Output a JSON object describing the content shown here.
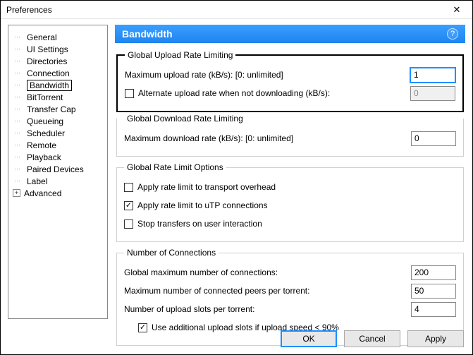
{
  "window": {
    "title": "Preferences"
  },
  "tree": {
    "items": [
      {
        "label": "General"
      },
      {
        "label": "UI Settings"
      },
      {
        "label": "Directories"
      },
      {
        "label": "Connection"
      },
      {
        "label": "Bandwidth",
        "selected": true
      },
      {
        "label": "BitTorrent"
      },
      {
        "label": "Transfer Cap"
      },
      {
        "label": "Queueing"
      },
      {
        "label": "Scheduler"
      },
      {
        "label": "Remote"
      },
      {
        "label": "Playback"
      },
      {
        "label": "Paired Devices"
      },
      {
        "label": "Label"
      },
      {
        "label": "Advanced",
        "expandable": true
      }
    ]
  },
  "panel": {
    "title": "Bandwidth",
    "upload": {
      "legend": "Global Upload Rate Limiting",
      "max_label": "Maximum upload rate (kB/s): [0: unlimited]",
      "max_value": "1",
      "alt_label": "Alternate upload rate when not downloading (kB/s):",
      "alt_checked": false,
      "alt_value": "0"
    },
    "download": {
      "legend": "Global Download Rate Limiting",
      "max_label": "Maximum download rate (kB/s): [0: unlimited]",
      "max_value": "0"
    },
    "options": {
      "legend": "Global Rate Limit Options",
      "overhead_label": "Apply rate limit to transport overhead",
      "overhead_checked": false,
      "utp_label": "Apply rate limit to uTP connections",
      "utp_checked": true,
      "stop_label": "Stop transfers on user interaction",
      "stop_checked": false
    },
    "connections": {
      "legend": "Number of Connections",
      "global_label": "Global maximum number of connections:",
      "global_value": "200",
      "peers_label": "Maximum number of connected peers per torrent:",
      "peers_value": "50",
      "slots_label": "Number of upload slots per torrent:",
      "slots_value": "4",
      "addl_label": "Use additional upload slots if upload speed < 90%",
      "addl_checked": true
    }
  },
  "buttons": {
    "ok": "OK",
    "cancel": "Cancel",
    "apply": "Apply"
  }
}
